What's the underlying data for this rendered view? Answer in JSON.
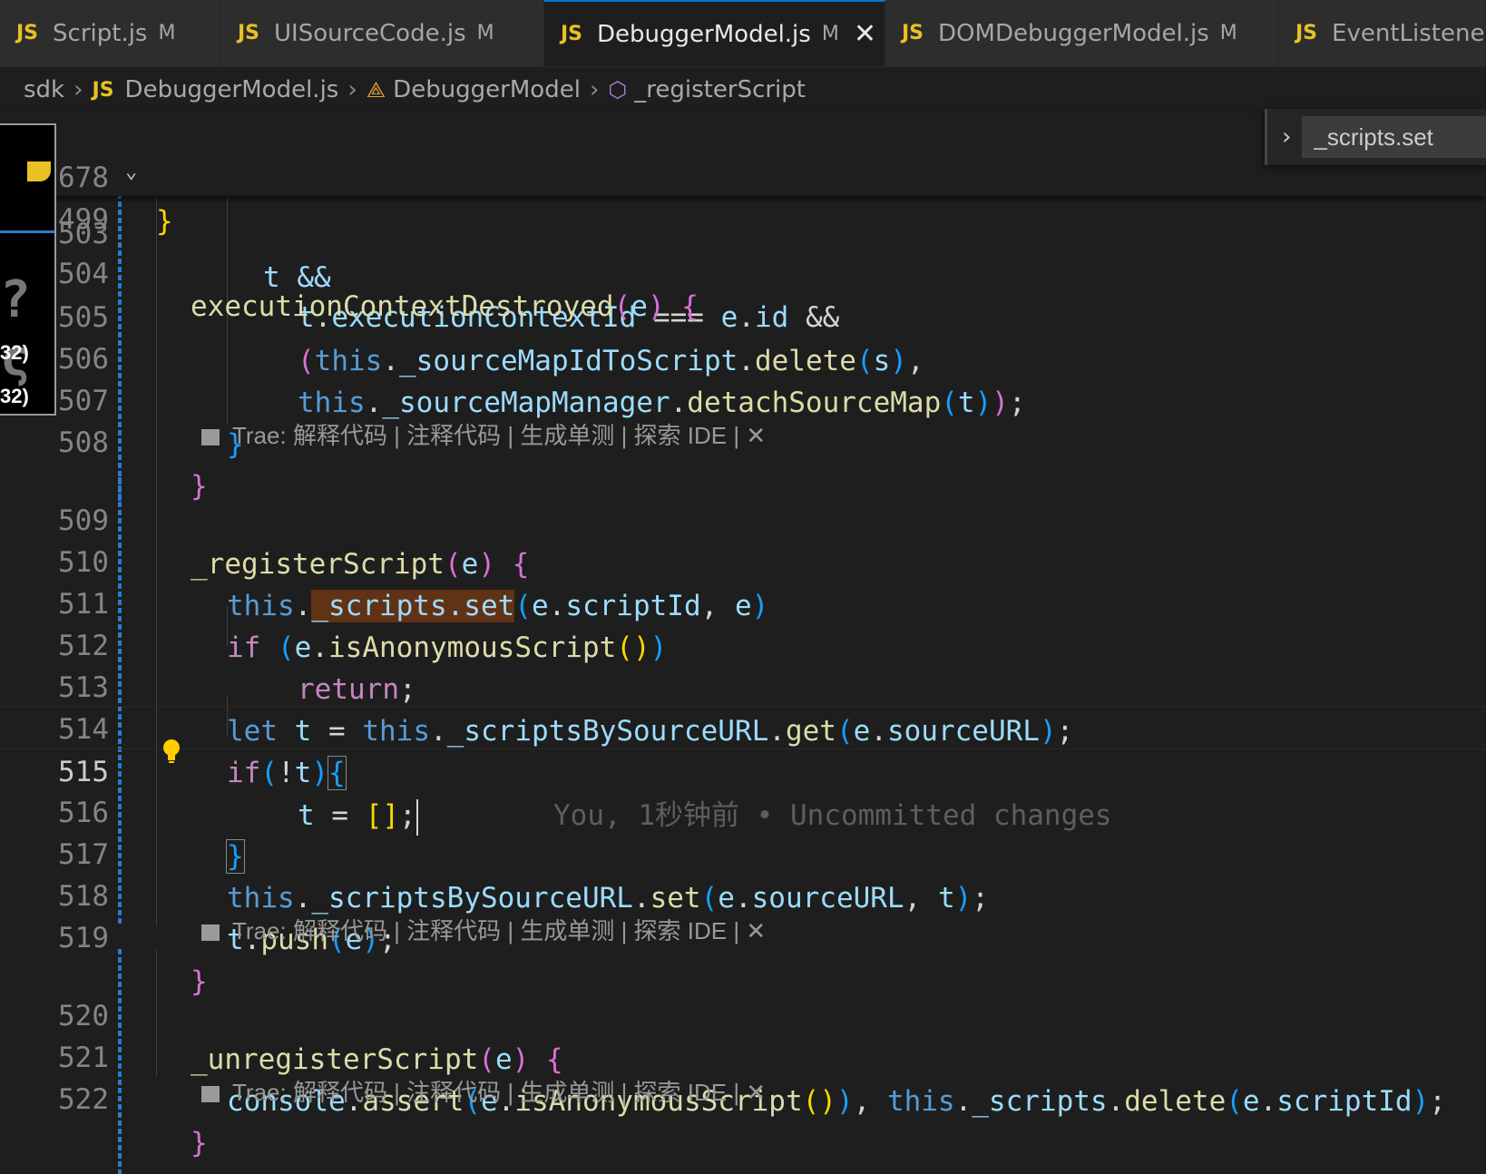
{
  "tabs": [
    {
      "lang": "JS",
      "name": "Script.js",
      "status": "M"
    },
    {
      "lang": "JS",
      "name": "UISourceCode.js",
      "status": "M"
    },
    {
      "lang": "JS",
      "name": "DebuggerModel.js",
      "status": "M",
      "close": "✕"
    },
    {
      "lang": "JS",
      "name": "DOMDebuggerModel.js",
      "status": "M"
    },
    {
      "lang": "JS",
      "name": "EventListener",
      "status": ""
    }
  ],
  "breadcrumb": {
    "folder": "sdk",
    "file_lang": "JS",
    "file": "DebuggerModel.js",
    "class": "DebuggerModel",
    "method": "_registerScript"
  },
  "find": {
    "value": "_scripts.set"
  },
  "peek": {
    "line1": "32)",
    "line2": "32)"
  },
  "sticky": {
    "ln1": "678",
    "ln2": "499",
    "code1": "}",
    "code2_fn": "executionContextDestroyed",
    "code2_arg": "e"
  },
  "lines": {
    "l503": "503",
    "l504": "504",
    "l505": "505",
    "l506": "506",
    "l507": "507",
    "l508": "508",
    "l509": "509",
    "l510": "510",
    "l511": "511",
    "l512": "512",
    "l513": "513",
    "l514": "514",
    "l515": "515",
    "l516": "516",
    "l517": "517",
    "l518": "518",
    "l519": "519",
    "l520": "520",
    "l521": "521",
    "l522": "522"
  },
  "code": {
    "c503": "t &&",
    "c504_a": "t",
    "c504_b": "executionContextId",
    "c504_c": "===",
    "c504_d": "e",
    "c504_e": "id",
    "c504_f": "&&",
    "c505_this": "this",
    "c505_prop": "_sourceMapIdToScript",
    "c505_fn": "delete",
    "c505_arg": "s",
    "c506_this": "this",
    "c506_prop": "_sourceMapManager",
    "c506_fn": "detachSourceMap",
    "c506_arg": "t",
    "c509_fn": "_registerScript",
    "c509_arg": "e",
    "c510_this": "this",
    "c510_hl": "_scripts.set",
    "c510_a": "e",
    "c510_b": "scriptId",
    "c510_c": "e",
    "c511_if": "if",
    "c511_a": "e",
    "c511_fn": "isAnonymousScript",
    "c512_ret": "return",
    "c513_let": "let",
    "c513_t": "t",
    "c513_this": "this",
    "c513_prop": "_scriptsBySourceURL",
    "c513_fn": "get",
    "c513_a": "e",
    "c513_b": "sourceURL",
    "c514_if": "if",
    "c514_t": "t",
    "c515_t": "t",
    "c515_ghost": "You, 1秒钟前 • Uncommitted changes",
    "c517_this": "this",
    "c517_prop": "_scriptsBySourceURL",
    "c517_fn": "set",
    "c517_a": "e",
    "c517_b": "sourceURL",
    "c517_t": "t",
    "c518_t": "t",
    "c518_fn": "push",
    "c518_a": "e",
    "c520_fn": "_unregisterScript",
    "c520_arg": "e",
    "c521_console": "console",
    "c521_fn": "assert",
    "c521_a": "e",
    "c521_fn2": "isAnonymousScript",
    "c521_this": "this",
    "c521_prop": "_scripts",
    "c521_del": "delete",
    "c521_b": "e",
    "c521_c": "scriptId"
  },
  "codelens": "Trae: 解释代码 | 注释代码 | 生成单测 | 探索 IDE | ✕"
}
